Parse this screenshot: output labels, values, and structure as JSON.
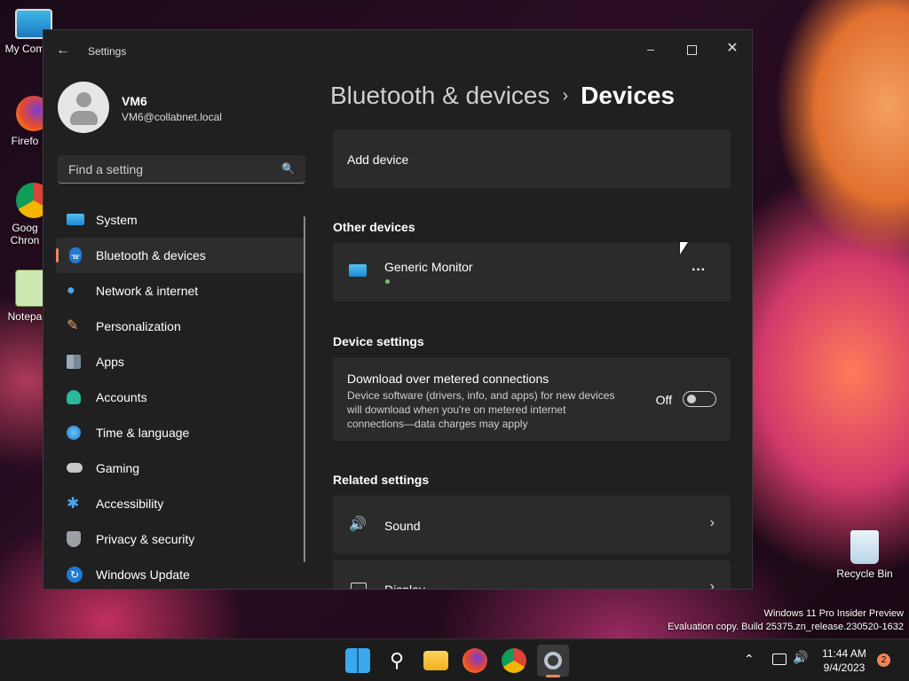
{
  "desktop": {
    "icons": [
      {
        "label": "My Com"
      },
      {
        "label": "Firefo"
      },
      {
        "label": "Goog\nChron"
      },
      {
        "label": "Notepa"
      }
    ],
    "recycle_bin": "Recycle Bin",
    "watermark_line1": "Windows 11 Pro Insider Preview",
    "watermark_line2": "Evaluation copy. Build 25375.zn_release.230520-1632"
  },
  "window": {
    "title": "Settings",
    "profile": {
      "name": "VM6",
      "email": "VM6@collabnet.local"
    },
    "search": {
      "placeholder": "Find a setting"
    },
    "nav": [
      {
        "label": "System"
      },
      {
        "label": "Bluetooth & devices"
      },
      {
        "label": "Network & internet"
      },
      {
        "label": "Personalization"
      },
      {
        "label": "Apps"
      },
      {
        "label": "Accounts"
      },
      {
        "label": "Time & language"
      },
      {
        "label": "Gaming"
      },
      {
        "label": "Accessibility"
      },
      {
        "label": "Privacy & security"
      },
      {
        "label": "Windows Update"
      }
    ],
    "breadcrumb": {
      "parent": "Bluetooth & devices",
      "current": "Devices"
    },
    "add_device": "Add device",
    "other_devices_heading": "Other devices",
    "device": {
      "name": "Generic Monitor",
      "more": "···"
    },
    "device_settings_heading": "Device settings",
    "metered": {
      "title": "Download over metered connections",
      "description": "Device software (drivers, info, and apps) for new devices will download when you're on metered internet connections—data charges may apply",
      "state": "Off"
    },
    "related_heading": "Related settings",
    "related": [
      {
        "label": "Sound"
      },
      {
        "label": "Display"
      }
    ]
  },
  "taskbar": {
    "time": "11:44 AM",
    "date": "9/4/2023",
    "notifications": "2"
  },
  "colors": {
    "accent": "#f4845a",
    "background": "#202020",
    "card": "#2b2b2b"
  }
}
